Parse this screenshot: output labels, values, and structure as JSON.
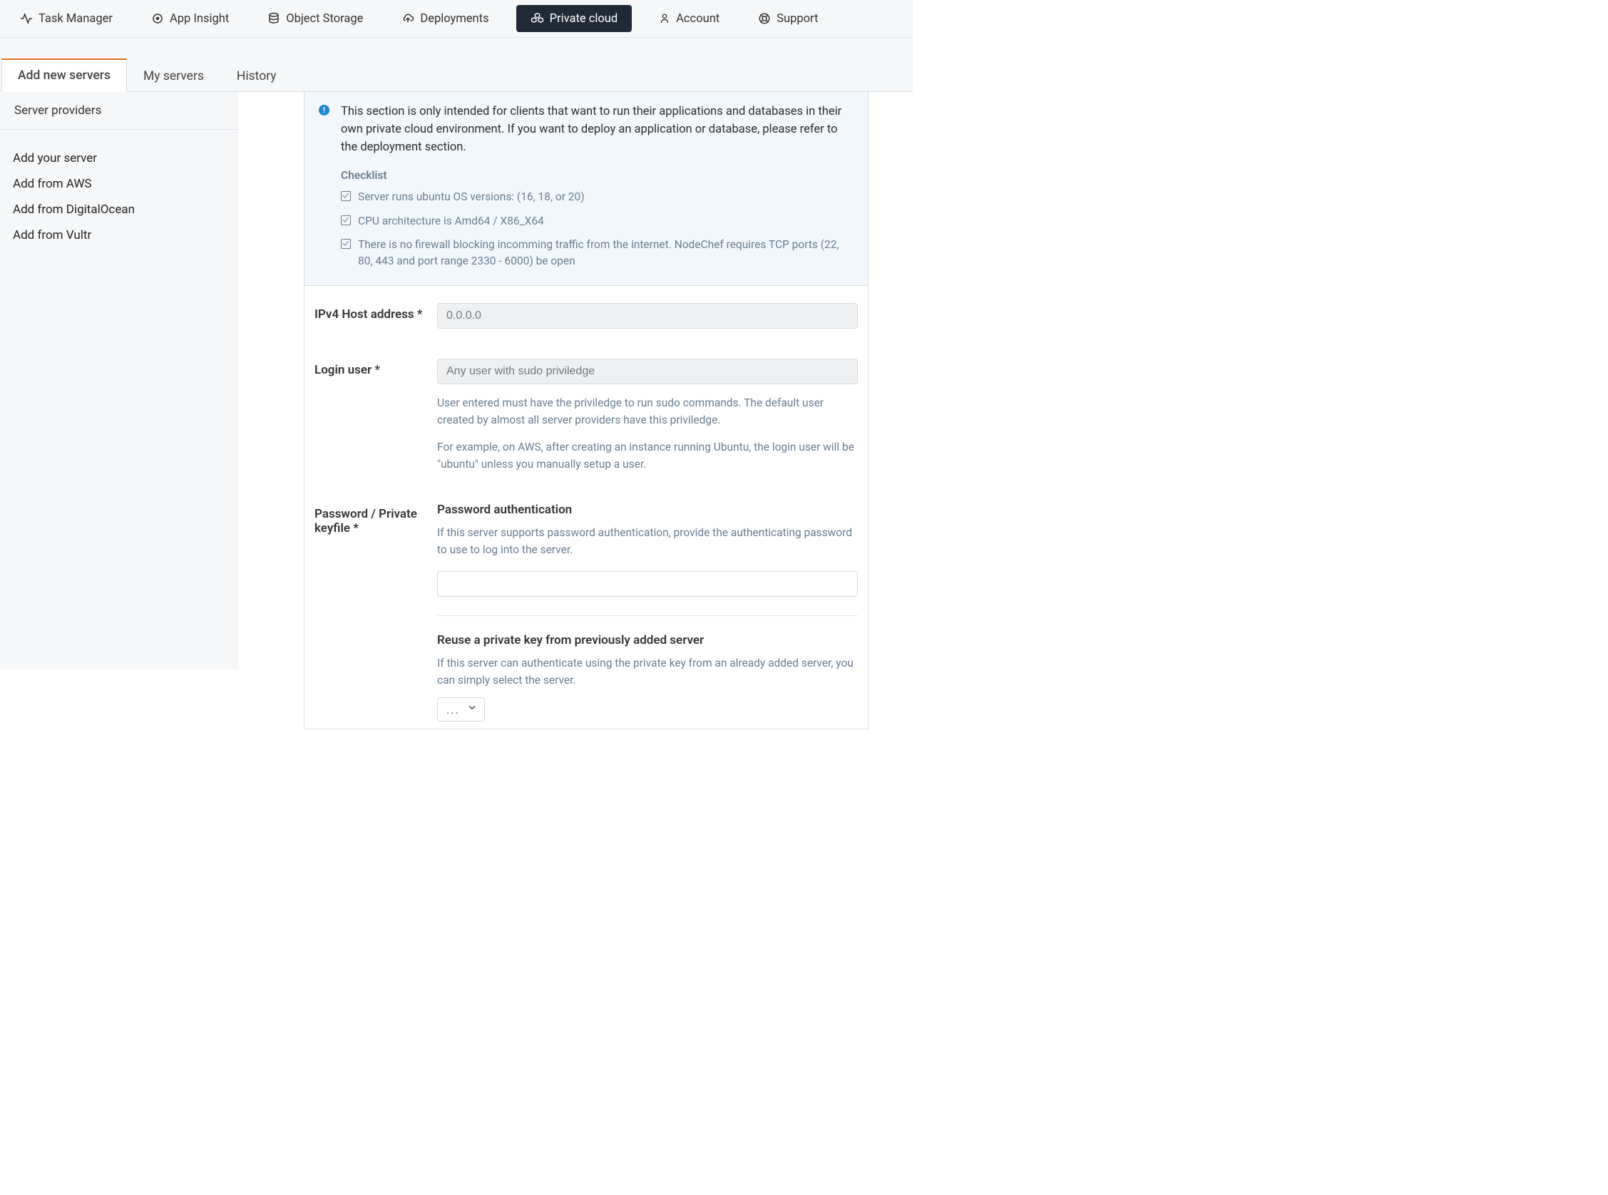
{
  "topnav": {
    "task_manager": "Task Manager",
    "app_insight": "App Insight",
    "object_storage": "Object Storage",
    "deployments": "Deployments",
    "private_cloud": "Private cloud",
    "account": "Account",
    "support": "Support"
  },
  "subtabs": {
    "add_new_servers": "Add new servers",
    "my_servers": "My servers",
    "history": "History"
  },
  "sidebar": {
    "header": "Server providers",
    "add_your_server": "Add your server",
    "add_from_aws": "Add from AWS",
    "add_from_do": "Add from DigitalOcean",
    "add_from_vultr": "Add from Vultr"
  },
  "info": {
    "text": "This section is only intended for clients that want to run their applications and databases in their own private cloud environment. If you want to deploy an application or database, please refer to the deployment section.",
    "checklist_title": "Checklist",
    "c1": "Server runs ubuntu OS versions: (16, 18, or 20)",
    "c2": "CPU architecture is Amd64 / X86_X64",
    "c3": "There is no firewall blocking incomming traffic from the internet. NodeChef requires TCP ports (22, 80, 443 and port range 2330 - 6000) be open"
  },
  "form": {
    "ipv4_label": "IPv4 Host address *",
    "ipv4_placeholder": "0.0.0.0",
    "login_label": "Login user *",
    "login_placeholder": "Any user with sudo priviledge",
    "login_help1": "User entered must have the priviledge to run sudo commands. The default user created by almost all server providers have this priviledge.",
    "login_help2": "For example, on AWS, after creating an instance running Ubuntu, the login user will be \"ubuntu\" unless you manually setup a user.",
    "pw_label": "Password / Private keyfile *",
    "pw_auth_title": "Password authentication",
    "pw_auth_help": "If this server supports password authentication, provide the authenticating password to use to log into the server.",
    "reuse_title": "Reuse a private key from previously added server",
    "reuse_help": "If this server can authenticate using the private key from an already added server, you can simply select the server.",
    "select_value": "..."
  }
}
